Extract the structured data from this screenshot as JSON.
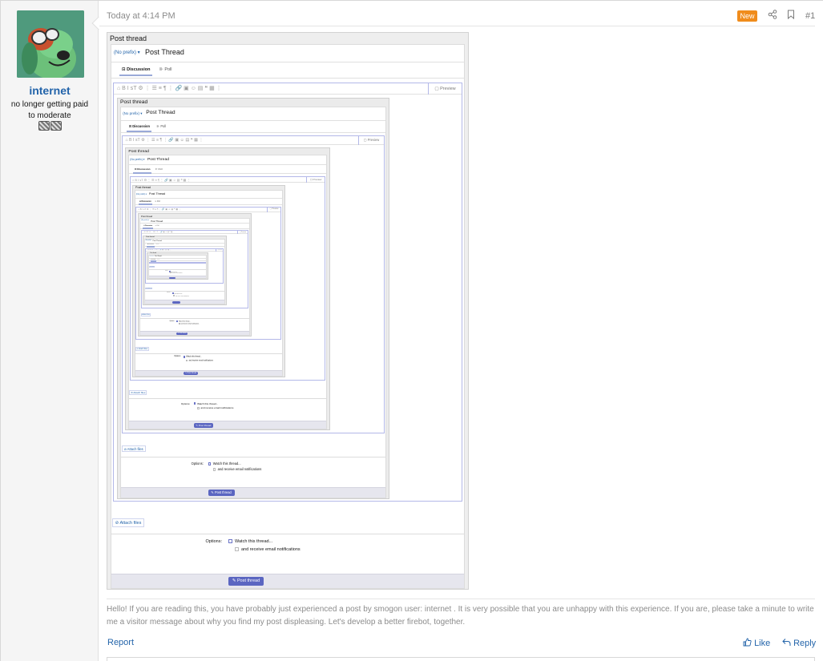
{
  "user": {
    "name": "internet",
    "title": "no longer getting paid to moderate",
    "avatar_icon": "cartoon-dog-aviator-avatar-icon",
    "badges": [
      "badge-icon",
      "badge-icon"
    ]
  },
  "post": {
    "timestamp": "Today at 4:14 PM",
    "new_badge": "New",
    "post_number": "#1",
    "share_icon": "share-icon",
    "bookmark_icon": "bookmark-icon"
  },
  "form": {
    "header": "Post thread",
    "prefix": "(No prefix)",
    "title_value": "Post Thread",
    "tab_discussion": "Discussion",
    "tab_poll": "Poll",
    "preview": "Preview",
    "attach": "Attach files",
    "options_label": "Options:",
    "watch": "Watch this thread...",
    "email": "and receive email notifications",
    "submit": "Post thread"
  },
  "message": "Hello! If you are reading this, you have probably just experienced a post by smogon user: internet . It is very possible that you are unhappy with this experience. If you are, please take a minute to write me a visitor message about why you find my post displeasing. Let's develop a better firebot, together.",
  "actions": {
    "report": "Report",
    "like": "Like",
    "reply": "Reply"
  },
  "colors": {
    "link": "#2364aa",
    "new_badge": "#f08c1c",
    "submit": "#5b66c1"
  }
}
